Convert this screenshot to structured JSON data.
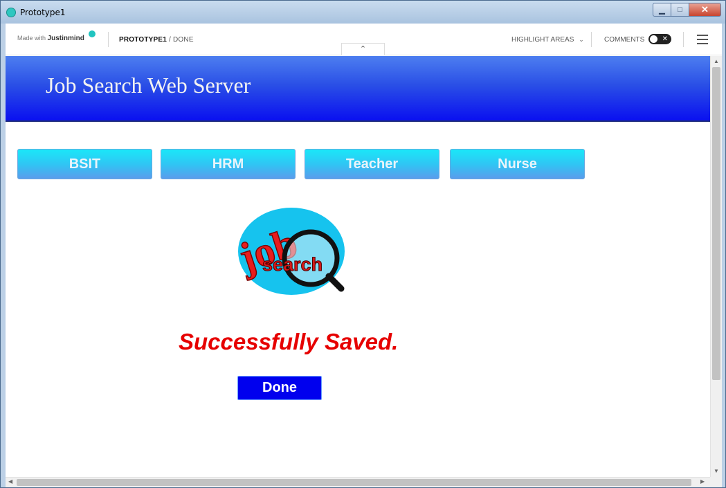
{
  "window": {
    "title": "Prototype1",
    "controls": {
      "minimize": "▁",
      "maximize": "□",
      "close": "✕"
    }
  },
  "toolbar": {
    "made_with": "Made with",
    "brand": "Justinmind",
    "breadcrumb_project": "PROTOTYPE1",
    "breadcrumb_sep": " / ",
    "breadcrumb_page": "DONE",
    "highlight_label": "HIGHLIGHT AREAS",
    "comments_label": "COMMENTS",
    "comments_toggle_x": "✕",
    "collapse_glyph": "⌃"
  },
  "page": {
    "banner_title": "Job Search Web Server",
    "nav": [
      {
        "label": "BSIT"
      },
      {
        "label": "HRM"
      },
      {
        "label": "Teacher"
      },
      {
        "label": "Nurse"
      }
    ],
    "logo": {
      "text_top": "job",
      "text_bottom": "search"
    },
    "message": "Successfully Saved.",
    "done_label": "Done"
  },
  "scroll": {
    "up": "▲",
    "down": "▼",
    "left": "◀",
    "right": "▶"
  },
  "colors": {
    "banner_top": "#4d7ef0",
    "banner_bottom": "#0a10f0",
    "nav_button": "#2fc6f4",
    "success_text": "#e60000",
    "done_button": "#0000ee",
    "brand_dot": "#21c4c0"
  }
}
